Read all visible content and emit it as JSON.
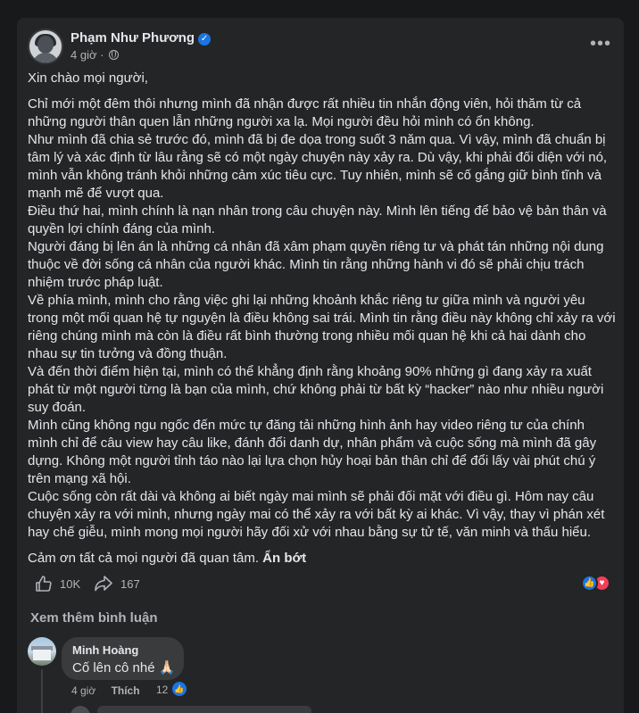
{
  "post": {
    "author": "Phạm Như Phương",
    "time": "4 giờ",
    "time_separator": "·",
    "greeting": "Xin chào mọi người,",
    "paragraphs": [
      "Chỉ mới một đêm thôi nhưng mình đã nhận được rất nhiều tin nhắn động viên, hỏi thăm từ cả những người thân quen lẫn những người xa lạ. Mọi người đều hỏi mình có ổn không.",
      "Như mình đã chia sẻ trước đó, mình đã bị đe dọa trong suốt 3 năm qua. Vì vậy, mình đã chuẩn bị tâm lý và xác định từ lâu rằng sẽ có một ngày chuyện này xảy ra. Dù vậy, khi phải đối diện với nó, mình vẫn không tránh khỏi những cảm xúc tiêu cực. Tuy nhiên, mình sẽ cố gắng giữ bình tĩnh và mạnh mẽ để vượt qua.",
      "Điều thứ hai, mình chính là nạn nhân trong câu chuyện này. Mình lên tiếng để bảo vệ bản thân và quyền lợi chính đáng của mình.",
      "Người đáng bị lên án là những cá nhân đã xâm phạm quyền riêng tư và phát tán những nội dung thuộc về đời sống cá nhân của người khác. Mình tin rằng những hành vi đó sẽ phải chịu trách nhiệm trước pháp luật.",
      "Về phía mình, mình cho rằng việc ghi lại những khoảnh khắc riêng tư giữa mình và người yêu trong một mối quan hệ tự nguyện là điều không sai trái. Mình tin rằng điều này không chỉ xảy ra với riêng chúng mình mà còn là điều rất bình thường trong nhiều mối quan hệ khi cả hai dành cho nhau sự tin tưởng và đồng thuận.",
      "Và đến thời điểm hiện tại, mình có thể khẳng định rằng khoảng 90% những gì đang xảy ra xuất phát từ một người từng là bạn của mình, chứ không phải từ bất kỳ “hacker” nào như nhiều người suy đoán.",
      "Mình cũng không ngu ngốc đến mức tự đăng tải những hình ảnh hay video riêng tư của chính mình chỉ để câu view hay câu like, đánh đổi danh dự, nhân phẩm và cuộc sống mà mình đã gây dựng. Không một người tỉnh táo nào lại lựa chọn hủy hoại bản thân chỉ để đổi lấy vài phút chú ý trên mạng xã hội.",
      "Cuộc sống còn rất dài và không ai biết ngày mai mình sẽ phải đối mặt với điều gì. Hôm nay câu chuyện xảy ra với mình, nhưng ngày mai có thể xảy ra với bất kỳ ai khác. Vì vậy, thay vì phán xét hay chế giễu, mình mong mọi người hãy đối xử với nhau bằng sự tử tế, văn minh và thấu hiểu."
    ],
    "thanks": "Cảm ơn tất cả mọi người đã quan tâm.",
    "see_less": "Ẩn bớt",
    "like_count": "10K",
    "share_count": "167",
    "more_icon": "more-horizontal-icon",
    "verified_icon": "verified-badge-icon",
    "privacy_icon": "globe-icon"
  },
  "comments": {
    "view_more": "Xem thêm bình luận",
    "items": [
      {
        "author": "Minh Hoàng",
        "text": "Cố lên cô nhé 🙏🏻",
        "time": "4 giờ",
        "like_label": "Thích",
        "reaction_count": "12"
      }
    ]
  },
  "colors": {
    "background": "#18191a",
    "card": "#242526",
    "bubble": "#3a3b3c",
    "primary_text": "#e4e6eb",
    "secondary_text": "#b0b3b8",
    "like_blue": "#1b74e4",
    "love_red": "#f33e58"
  }
}
